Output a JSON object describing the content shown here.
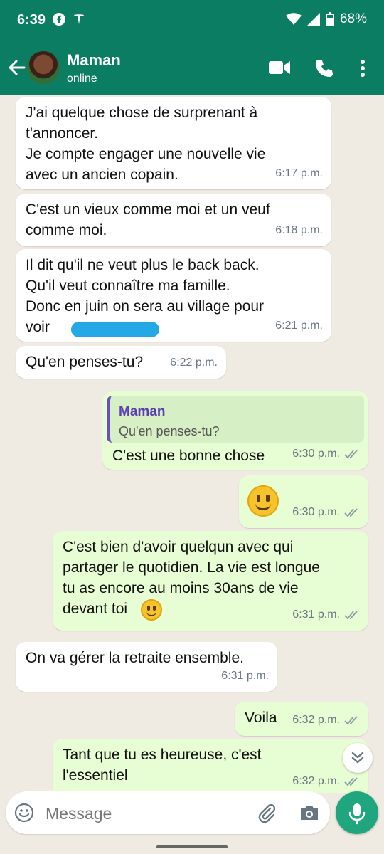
{
  "status": {
    "time": "6:39",
    "battery": "68%"
  },
  "header": {
    "name": "Maman",
    "status": "online"
  },
  "messages": [
    {
      "text": "J'ai quelque chose de surprenant à\nt'annoncer.\nJe compte engager une nouvelle vie\navec un ancien copain.",
      "time": "6:17 p.m."
    },
    {
      "text": "C'est un vieux comme moi et un veuf\ncomme moi.",
      "time": "6:18 p.m."
    },
    {
      "text": "Il dit qu'il ne veut plus le back back.\nQu'il veut connaître ma famille.\nDonc en juin on sera au village pour\nvoir",
      "time": "6:21 p.m."
    },
    {
      "text": "Qu'en penses-tu?",
      "time": "6:22 p.m."
    },
    {
      "quote_name": "Maman",
      "quote_text": "Qu'en penses-tu?",
      "text": "C'est une bonne chose",
      "time": "6:30 p.m."
    },
    {
      "time": "6:30 p.m."
    },
    {
      "text": "C'est bien d'avoir quelqun avec qui\npartager le quotidien. La vie est longue\ntu as encore au moins 30ans de vie\ndevant toi",
      "time": "6:31 p.m."
    },
    {
      "text": "On va gérer la retraite ensemble.",
      "time": "6:31 p.m."
    },
    {
      "text": "Voila",
      "time": "6:32 p.m."
    },
    {
      "text": "Tant que tu es heureuse, c'est\nl'essentiel",
      "time": "6:32 p.m."
    }
  ],
  "input": {
    "placeholder": "Message"
  },
  "colors": {
    "header": "#0b7d62",
    "outgoing": "#e7fdd3",
    "incoming": "#ffffff",
    "background": "#efeae2",
    "mic": "#1fa67f"
  }
}
